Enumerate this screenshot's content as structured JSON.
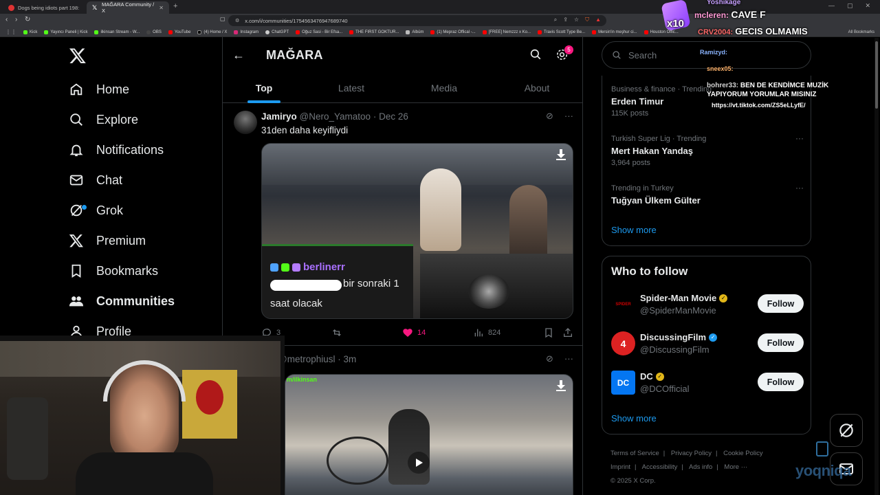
{
  "browser": {
    "tabs": [
      {
        "title": "Dogs being idiots part 198: Dogs loo..."
      },
      {
        "title": "MAĞARA Community / X"
      }
    ],
    "url": "x.com/i/communities/1754563476947689740",
    "bookmarks": [
      "Kick",
      "Yayıncı Paneli | Kick",
      "ilkinsan Stream - W...",
      "OBS",
      "YouTube",
      "(4) Home / X",
      "Instagram",
      "ChatGPT",
      "Oğuz Sasi - Bir Efsa...",
      "THE FIRST GOKTUR...",
      "Albüm",
      "(1) Mepraz Offical -...",
      "[FREE] Nemzzz x Ko...",
      "Travis Scott Type Be...",
      "Mersin'in meşhur ci...",
      "Houston Offic..."
    ],
    "all_bookmarks": "All Bookmarks"
  },
  "nav": {
    "items": [
      {
        "label": "Home",
        "icon": "home-icon"
      },
      {
        "label": "Explore",
        "icon": "search-icon"
      },
      {
        "label": "Notifications",
        "icon": "bell-icon"
      },
      {
        "label": "Chat",
        "icon": "mail-icon"
      },
      {
        "label": "Grok",
        "icon": "grok-icon"
      },
      {
        "label": "Premium",
        "icon": "x-icon"
      },
      {
        "label": "Bookmarks",
        "icon": "bookmark-icon"
      },
      {
        "label": "Communities",
        "icon": "people-icon"
      },
      {
        "label": "Profile",
        "icon": "person-icon"
      }
    ]
  },
  "community": {
    "title": "MAĞARA",
    "notif_count": "5",
    "tabs": [
      "Top",
      "Latest",
      "Media",
      "About"
    ],
    "active_tab": "Top"
  },
  "tweets": [
    {
      "name": "Jamiryo",
      "handle": "@Nero_Yamatoo",
      "time": "Dec 26",
      "text": "31den daha keyifliydi",
      "media_chat": {
        "user": "berlinerr",
        "message_a": "bir sonraki 1",
        "message_b": "saat olacak"
      },
      "replies": "3",
      "reposts": "",
      "likes": "14",
      "views": "824"
    },
    {
      "name": "",
      "handle": "@metrophiusl",
      "time": "3m",
      "media_overlay": "m/ilkinsan"
    }
  ],
  "search": {
    "placeholder": "Search"
  },
  "trends": [
    {
      "context": "Business & finance · Trending",
      "title": "Erden Timur",
      "posts": "115K posts"
    },
    {
      "context": "Turkish Super Lig · Trending",
      "title": "Mert Hakan Yandaş",
      "posts": "3,964 posts"
    },
    {
      "context": "Trending in Turkey",
      "title": "Tuğyan Ülkem Gülter",
      "posts": ""
    }
  ],
  "trends_show_more": "Show more",
  "who_to_follow": {
    "title": "Who to follow",
    "accounts": [
      {
        "name": "Spider-Man Movie",
        "handle": "@SpiderManMovie",
        "badge": "gold"
      },
      {
        "name": "DiscussingFilm",
        "handle": "@DiscussingFilm",
        "badge": "blue"
      },
      {
        "name": "DC",
        "handle": "@DCOfficial",
        "badge": "gold"
      }
    ],
    "follow_label": "Follow",
    "show_more": "Show more"
  },
  "footer": {
    "links": [
      "Terms of Service",
      "Privacy Policy",
      "Cookie Policy",
      "Imprint",
      "Accessibility",
      "Ads info",
      "More ···"
    ],
    "copyright": "© 2025 X Corp."
  },
  "stream_chat": [
    {
      "user": "Yoshikage",
      "message": ""
    },
    {
      "user": "mcleren:",
      "message": "CAVE F"
    },
    {
      "user": "CRV2004:",
      "message": "GECIS OLMAMIS"
    },
    {
      "user": "Ramizyd:",
      "message": ""
    },
    {
      "user": "sneex05:",
      "message": ""
    },
    {
      "user": "bohrer33:",
      "message": "BEN DE KENDİMCE MUZİK YAPIYORUM YORUMLAR MISINIZ"
    },
    {
      "user": "",
      "message": "https://vt.tiktok.com/ZS5eLLyfE/"
    }
  ],
  "stream_multiplier": "x10",
  "watermark": "yoqniqa",
  "colors": {
    "accent": "#1d9bf0",
    "like": "#f91880",
    "bg": "#000000",
    "border": "#2f3336"
  }
}
